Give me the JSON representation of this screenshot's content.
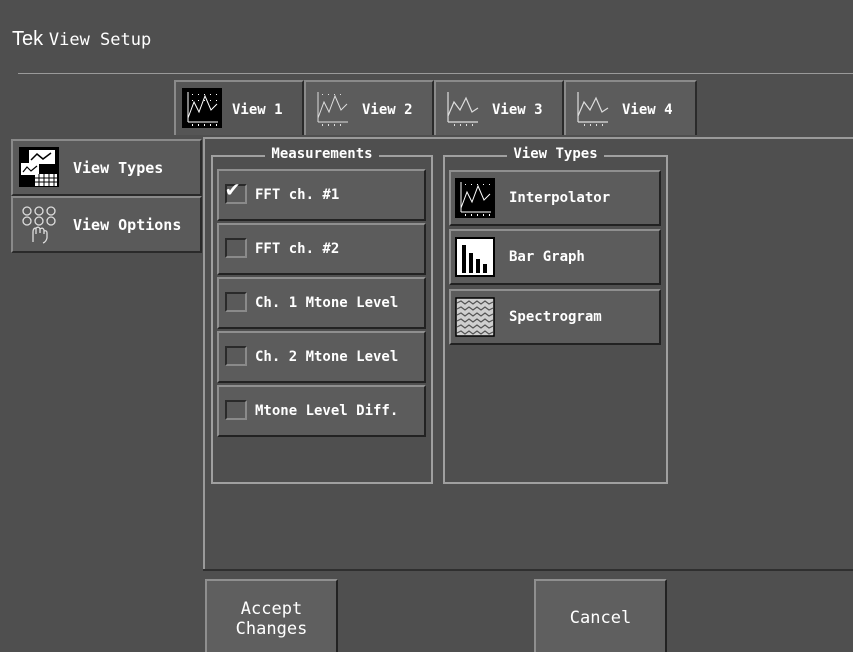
{
  "window": {
    "brand": "Tek",
    "title": "View Setup"
  },
  "tabs": [
    {
      "label": "View 1",
      "icon": "interpolator-graph-icon"
    },
    {
      "label": "View 2",
      "icon": "interpolator-graph-icon"
    },
    {
      "label": "View 3",
      "icon": "line-graph-icon"
    },
    {
      "label": "View 4",
      "icon": "line-graph-icon"
    }
  ],
  "sidebar": {
    "items": [
      {
        "label": "View Types",
        "icon": "view-types-icon"
      },
      {
        "label": "View Options",
        "icon": "view-options-icon"
      }
    ]
  },
  "measurements": {
    "title": "Measurements",
    "items": [
      {
        "label": "FFT ch. #1",
        "checked": true
      },
      {
        "label": "FFT ch. #2",
        "checked": false
      },
      {
        "label": "Ch. 1 Mtone Level",
        "checked": false
      },
      {
        "label": "Ch. 2 Mtone Level",
        "checked": false
      },
      {
        "label": "Mtone Level Diff.",
        "checked": false
      }
    ],
    "check_glyph": "✔"
  },
  "view_types": {
    "title": "View Types",
    "items": [
      {
        "label": "Interpolator",
        "icon": "interpolator-icon"
      },
      {
        "label": "Bar Graph",
        "icon": "bar-graph-icon"
      },
      {
        "label": "Spectrogram",
        "icon": "spectrogram-icon"
      }
    ]
  },
  "actions": {
    "accept_line1": "Accept",
    "accept_line2": "Changes",
    "cancel": "Cancel"
  },
  "colors": {
    "background": "#4f4f4f",
    "button": "#5c5c5c",
    "text": "#ffffff"
  }
}
